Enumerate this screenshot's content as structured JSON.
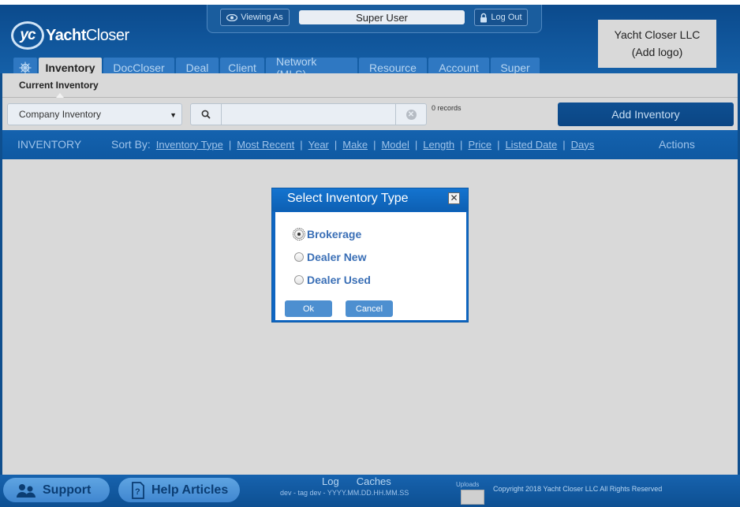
{
  "header": {
    "logo_text_bold": "Yacht",
    "logo_text_light": "Closer",
    "logo_mark": "yc",
    "viewing_as_label": "Viewing As",
    "current_user": "Super User",
    "logout_label": "Log Out",
    "company_name": "Yacht Closer LLC",
    "company_logo_placeholder": "(Add logo)"
  },
  "tabs": [
    {
      "label": "Inventory",
      "active": true
    },
    {
      "label": "DocCloser"
    },
    {
      "label": "Deal"
    },
    {
      "label": "Client"
    },
    {
      "label": "Network (MLS)"
    },
    {
      "label": "Resource"
    },
    {
      "label": "Account"
    },
    {
      "label": "Super"
    }
  ],
  "subtab": "Current Inventory",
  "toolbar": {
    "inventory_select": "Company Inventory",
    "search_placeholder": "",
    "records": "0 records",
    "add_button": "Add Inventory"
  },
  "sortbar": {
    "title": "INVENTORY",
    "sort_label": "Sort By:",
    "sort_options": [
      "Inventory Type",
      "Most Recent",
      "Year",
      "Make",
      "Model",
      "Length",
      "Price",
      "Listed Date",
      "Days"
    ],
    "actions": "Actions"
  },
  "modal": {
    "title": "Select Inventory Type",
    "options": [
      {
        "label": "Brokerage",
        "checked": true
      },
      {
        "label": "Dealer New",
        "checked": false
      },
      {
        "label": "Dealer Used",
        "checked": false
      }
    ],
    "ok_label": "Ok",
    "cancel_label": "Cancel"
  },
  "footer": {
    "support_label": "Support",
    "help_label": "Help Articles",
    "log_link": "Log",
    "caches_link": "Caches",
    "version": "dev - tag dev - YYYY.MM.DD.HH.MM.SS",
    "uploads_label": "Uploads",
    "copyright": "Copyright 2018 Yacht Closer LLC All Rights Reserved"
  },
  "colors": {
    "brand_blue": "#0b4a8c",
    "tab_blue": "#2f78c2",
    "modal_blue": "#0f66c2",
    "link_blue": "#3a6fb6",
    "background_gray": "#d9d9d9"
  }
}
